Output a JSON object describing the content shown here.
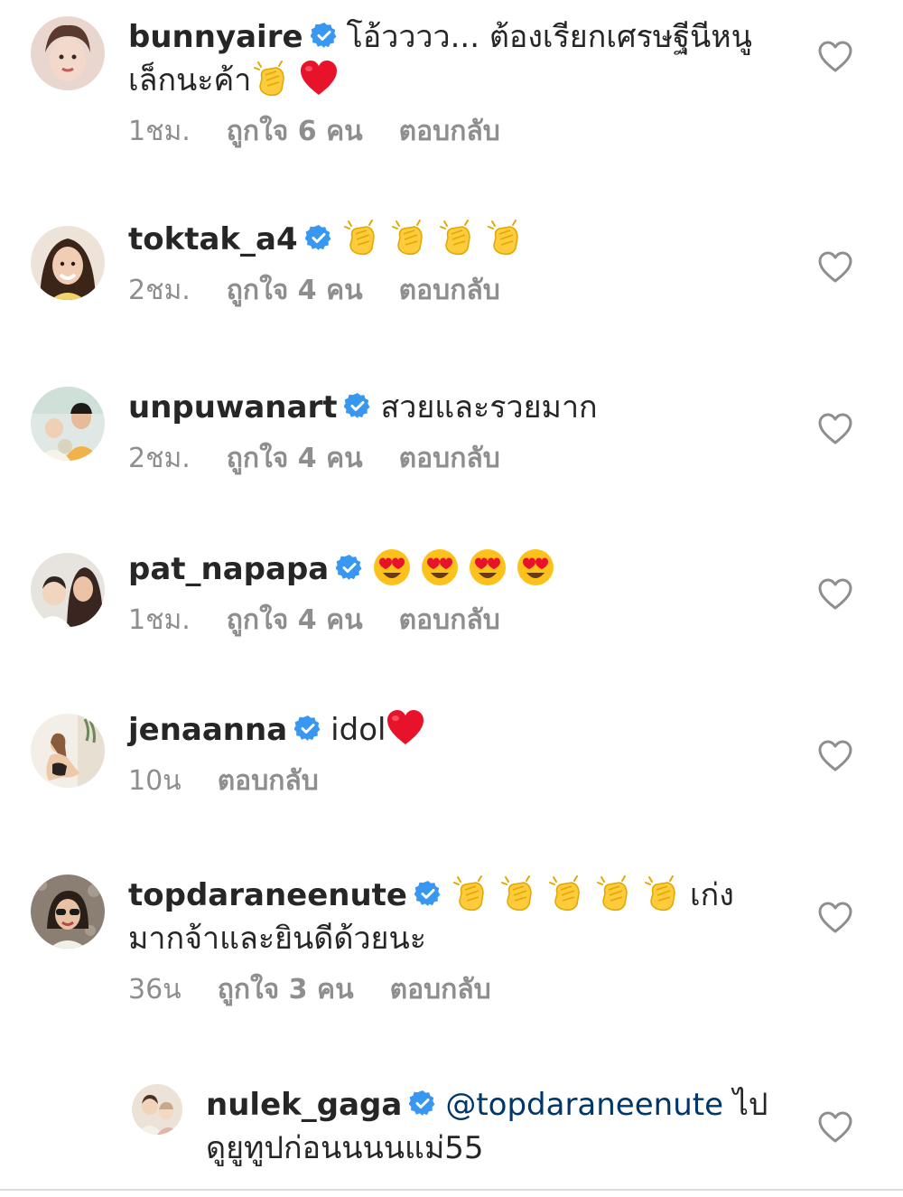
{
  "colors": {
    "text": "#262626",
    "secondary": "#8e8e8e",
    "verified_blue": "#3897f0",
    "mention": "#00376b",
    "heart_outline": "#8e8e8e"
  },
  "comments": [
    {
      "username": "bunnyaire",
      "verified": true,
      "text_before": "โอ้วววว... ต้องเรียกเศรษฐีนีหนูเล็กนะค้า",
      "emojis": [
        "clapping-hands-emoji",
        "red-heart-emoji"
      ],
      "time": "1ชม.",
      "likes": "ถูกใจ 6 คน",
      "reply_label": "ตอบกลับ"
    },
    {
      "username": "toktak_a4",
      "verified": true,
      "text_before": "",
      "emojis": [
        "clapping-hands-emoji",
        "clapping-hands-emoji",
        "clapping-hands-emoji",
        "clapping-hands-emoji"
      ],
      "time": "2ชม.",
      "likes": "ถูกใจ 4 คน",
      "reply_label": "ตอบกลับ"
    },
    {
      "username": "unpuwanart",
      "verified": true,
      "text_before": "สวยและรวยมาก",
      "emojis": [],
      "time": "2ชม.",
      "likes": "ถูกใจ 4 คน",
      "reply_label": "ตอบกลับ"
    },
    {
      "username": "pat_napapa",
      "verified": true,
      "text_before": "",
      "emojis": [
        "heart-eyes-emoji",
        "heart-eyes-emoji",
        "heart-eyes-emoji",
        "heart-eyes-emoji"
      ],
      "time": "1ชม.",
      "likes": "ถูกใจ 4 คน",
      "reply_label": "ตอบกลับ"
    },
    {
      "username": "jenaanna",
      "verified": true,
      "text_before": "idol",
      "emojis": [
        "red-heart-emoji"
      ],
      "time": "10น",
      "likes": "",
      "reply_label": "ตอบกลับ"
    },
    {
      "username": "topdaraneenute",
      "verified": true,
      "text_before": "",
      "emojis": [
        "clapping-hands-emoji",
        "clapping-hands-emoji",
        "clapping-hands-emoji",
        "clapping-hands-emoji",
        "clapping-hands-emoji"
      ],
      "text_after": "เก่งมากจ้าและยินดีด้วยนะ",
      "time": "36น",
      "likes": "ถูกใจ 3 คน",
      "reply_label": "ตอบกลับ"
    }
  ],
  "reply": {
    "username": "nulek_gaga",
    "verified": true,
    "mention": "@topdaraneenute",
    "text_after": "ไปดูยูทูปก่อนนนนแม่55"
  }
}
